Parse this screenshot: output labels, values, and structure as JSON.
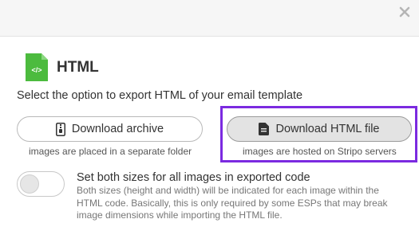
{
  "dialog": {
    "title": "HTML",
    "subtitle": "Select the option to export HTML of your email template",
    "file_icon_text": "</>"
  },
  "buttons": {
    "download_archive": {
      "label": "Download archive",
      "hint": "images are placed in a separate folder",
      "icon": "zip-archive-icon"
    },
    "download_html": {
      "label": "Download HTML file",
      "hint": "images are hosted on Stripo servers",
      "icon": "document-icon"
    }
  },
  "image_sizes_setting": {
    "title": "Set both sizes for all images in exported code",
    "description": "Both sizes (height and width) will be indicated for each image within the HTML code. Basically, this is only required by some ESPs that may break image dimensions while importing the HTML file.",
    "enabled": false
  },
  "colors": {
    "file_icon_green": "#4cbb3e",
    "highlight_purple": "#7b2ae0",
    "selected_button_bg": "#e3e3e3"
  }
}
